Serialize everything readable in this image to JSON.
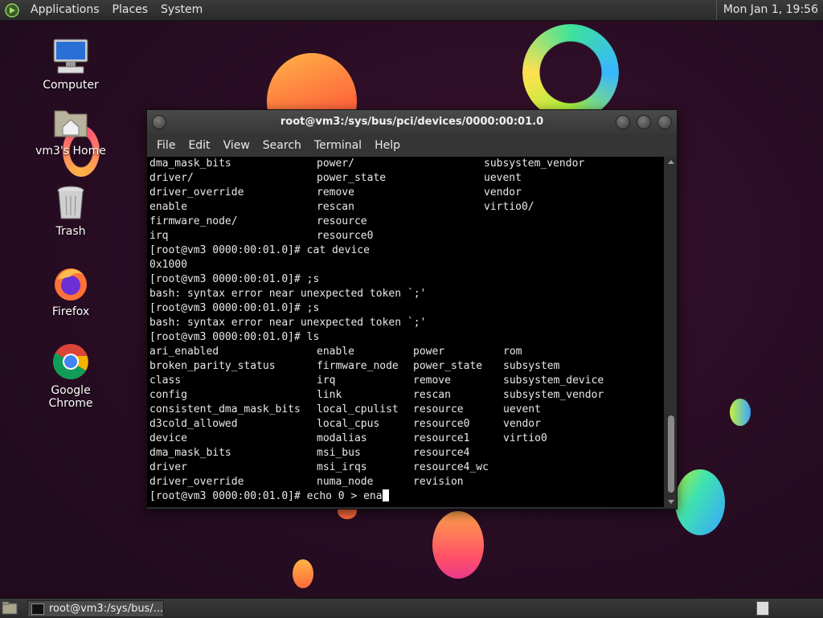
{
  "top_panel": {
    "menus": [
      "Applications",
      "Places",
      "System"
    ],
    "clock": "Mon Jan  1, 19:56"
  },
  "desktop_icons": [
    {
      "label": "Computer",
      "icon": "computer-icon"
    },
    {
      "label": "vm3's Home",
      "icon": "home-folder-icon"
    },
    {
      "label": "Trash",
      "icon": "trash-icon"
    },
    {
      "label": "Firefox",
      "icon": "firefox-icon"
    },
    {
      "label": "Google Chrome",
      "icon": "chrome-icon"
    }
  ],
  "terminal": {
    "title": "root@vm3:/sys/bus/pci/devices/0000:00:01.0",
    "menu": [
      "File",
      "Edit",
      "View",
      "Search",
      "Terminal",
      "Help"
    ],
    "lines": [
      {
        "cols": [
          "dma_mask_bits",
          "power/",
          "subsystem_vendor"
        ]
      },
      {
        "cols": [
          "driver/",
          "power_state",
          "uevent"
        ]
      },
      {
        "cols": [
          "driver_override",
          "remove",
          "vendor"
        ]
      },
      {
        "cols": [
          "enable",
          "rescan",
          "virtio0/"
        ]
      },
      {
        "cols": [
          "firmware_node/",
          "resource",
          ""
        ]
      },
      {
        "cols": [
          "irq",
          "resource0",
          ""
        ]
      },
      {
        "text": "[root@vm3 0000:00:01.0]# cat device"
      },
      {
        "text": "0x1000"
      },
      {
        "text": "[root@vm3 0000:00:01.0]# ;s"
      },
      {
        "text": "bash: syntax error near unexpected token `;'"
      },
      {
        "text": "[root@vm3 0000:00:01.0]# ;s"
      },
      {
        "text": "bash: syntax error near unexpected token `;'"
      },
      {
        "text": "[root@vm3 0000:00:01.0]# ls"
      },
      {
        "cols4": [
          "ari_enabled",
          "enable",
          "power",
          "rom"
        ]
      },
      {
        "cols4": [
          "broken_parity_status",
          "firmware_node",
          "power_state",
          "subsystem"
        ]
      },
      {
        "cols4": [
          "class",
          "irq",
          "remove",
          "subsystem_device"
        ]
      },
      {
        "cols4": [
          "config",
          "link",
          "rescan",
          "subsystem_vendor"
        ]
      },
      {
        "cols4": [
          "consistent_dma_mask_bits",
          "local_cpulist",
          "resource",
          "uevent"
        ]
      },
      {
        "cols4": [
          "d3cold_allowed",
          "local_cpus",
          "resource0",
          "vendor"
        ]
      },
      {
        "cols4": [
          "device",
          "modalias",
          "resource1",
          "virtio0"
        ]
      },
      {
        "cols4": [
          "dma_mask_bits",
          "msi_bus",
          "resource4",
          ""
        ]
      },
      {
        "cols4": [
          "driver",
          "msi_irqs",
          "resource4_wc",
          ""
        ]
      },
      {
        "cols4": [
          "driver_override",
          "numa_node",
          "revision",
          ""
        ]
      }
    ],
    "prompt": "[root@vm3 0000:00:01.0]# echo 0 > ena"
  },
  "taskbar": {
    "task_label": "root@vm3:/sys/bus/..."
  }
}
